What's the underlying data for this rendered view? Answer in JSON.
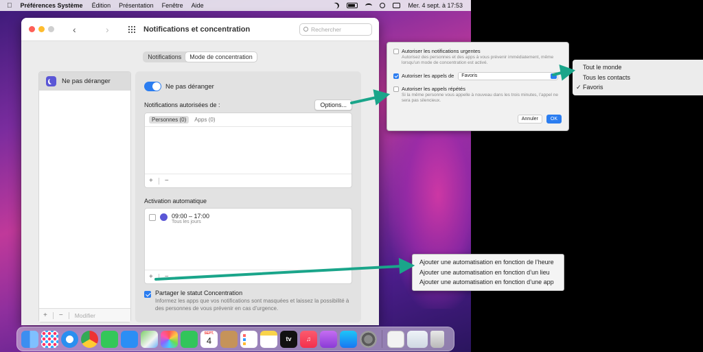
{
  "menubar": {
    "app": "Préférences Système",
    "items": [
      "Édition",
      "Présentation",
      "Fenêtre",
      "Aide"
    ],
    "clock": "Mer. 4 sept. à 17:53"
  },
  "window": {
    "title": "Notifications et concentration",
    "search_placeholder": "Rechercher",
    "tabs": [
      "Notifications",
      "Mode de concentration"
    ],
    "active_tab": "Mode de concentration"
  },
  "sidebar": {
    "items": [
      {
        "label": "Ne pas déranger",
        "icon": "moon-icon"
      }
    ],
    "add": "+",
    "remove": "−",
    "modify": "Modifier"
  },
  "panel": {
    "toggle_label": "Ne pas déranger",
    "toggle_on": true,
    "allowed_label": "Notifications autorisées de :",
    "options_button": "Options...",
    "allowed_tabs": [
      "Personnes (0)",
      "Apps (0)"
    ],
    "add": "+",
    "remove": "−",
    "auto_label": "Activation automatique",
    "schedule_time": "09:00 – 17:00",
    "schedule_days": "Tous les jours",
    "share_label": "Partager le statut Concentration",
    "share_checked": true,
    "share_desc": "Informez les apps que vos notifications sont masquées et laissez la possibilité à des personnes de vous prévenir en cas d’urgence."
  },
  "options_sheet": {
    "urgent_label": "Autoriser les notifications urgentes",
    "urgent_desc": "Autorisez des personnes et des apps à vous prévenir immédiatement, même lorsqu’un mode de concentration est activé.",
    "calls_label": "Autoriser les appels de",
    "calls_value": "Favoris",
    "repeat_label": "Autoriser les appels répétés",
    "repeat_desc": "Si la même personne vous appelle à nouveau dans les trois minutes, l’appel ne sera pas silencieux.",
    "cancel": "Annuler",
    "ok": "OK"
  },
  "calls_menu": {
    "items": [
      "Tout le monde",
      "Tous les contacts",
      "Favoris"
    ],
    "checked": "✓"
  },
  "automation_menu": {
    "items": [
      "Ajouter une automatisation en fonction de l’heure",
      "Ajouter une automatisation en fonction d’un lieu",
      "Ajouter une automatisation en fonction d’une app"
    ]
  },
  "dock": {
    "calendar_month": "SEPT.",
    "calendar_day": "4",
    "tv_label": "tv"
  },
  "colors": {
    "accent": "#2b7df0",
    "arrow": "#1aa58a",
    "focus_purple": "#5a56d6"
  }
}
